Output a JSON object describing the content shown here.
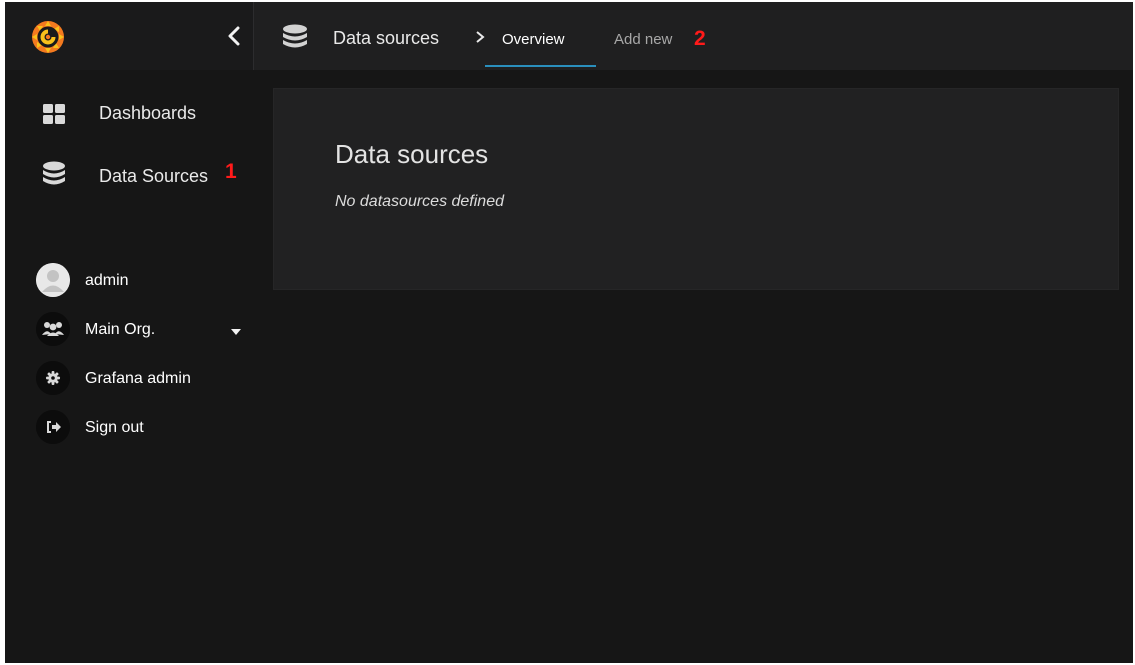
{
  "topbar": {
    "breadcrumb_section": "Data sources",
    "tabs": [
      {
        "label": "Overview",
        "active": true
      },
      {
        "label": "Add new",
        "active": false
      }
    ],
    "annotation_add_new": "2"
  },
  "sidebar": {
    "nav": [
      {
        "label": "Dashboards",
        "icon": "dashboards-grid-icon"
      },
      {
        "label": "Data Sources",
        "icon": "database-icon"
      }
    ],
    "annotation_data_sources": "1",
    "user": [
      {
        "label": "admin",
        "icon": "user-avatar-icon"
      },
      {
        "label": "Main Org.",
        "icon": "users-group-icon",
        "has_dropdown": true
      },
      {
        "label": "Grafana admin",
        "icon": "gear-icon"
      },
      {
        "label": "Sign out",
        "icon": "sign-out-icon"
      }
    ]
  },
  "main": {
    "title": "Data sources",
    "empty_message": "No datasources defined"
  },
  "colors": {
    "background": "#161616",
    "topbar": "#1f1f20",
    "panel": "#212122",
    "accent": "#2a8fbd",
    "annotation": "#ff1a1a",
    "logo_orange": "#f47a1f",
    "logo_yellow": "#f9c11b"
  }
}
